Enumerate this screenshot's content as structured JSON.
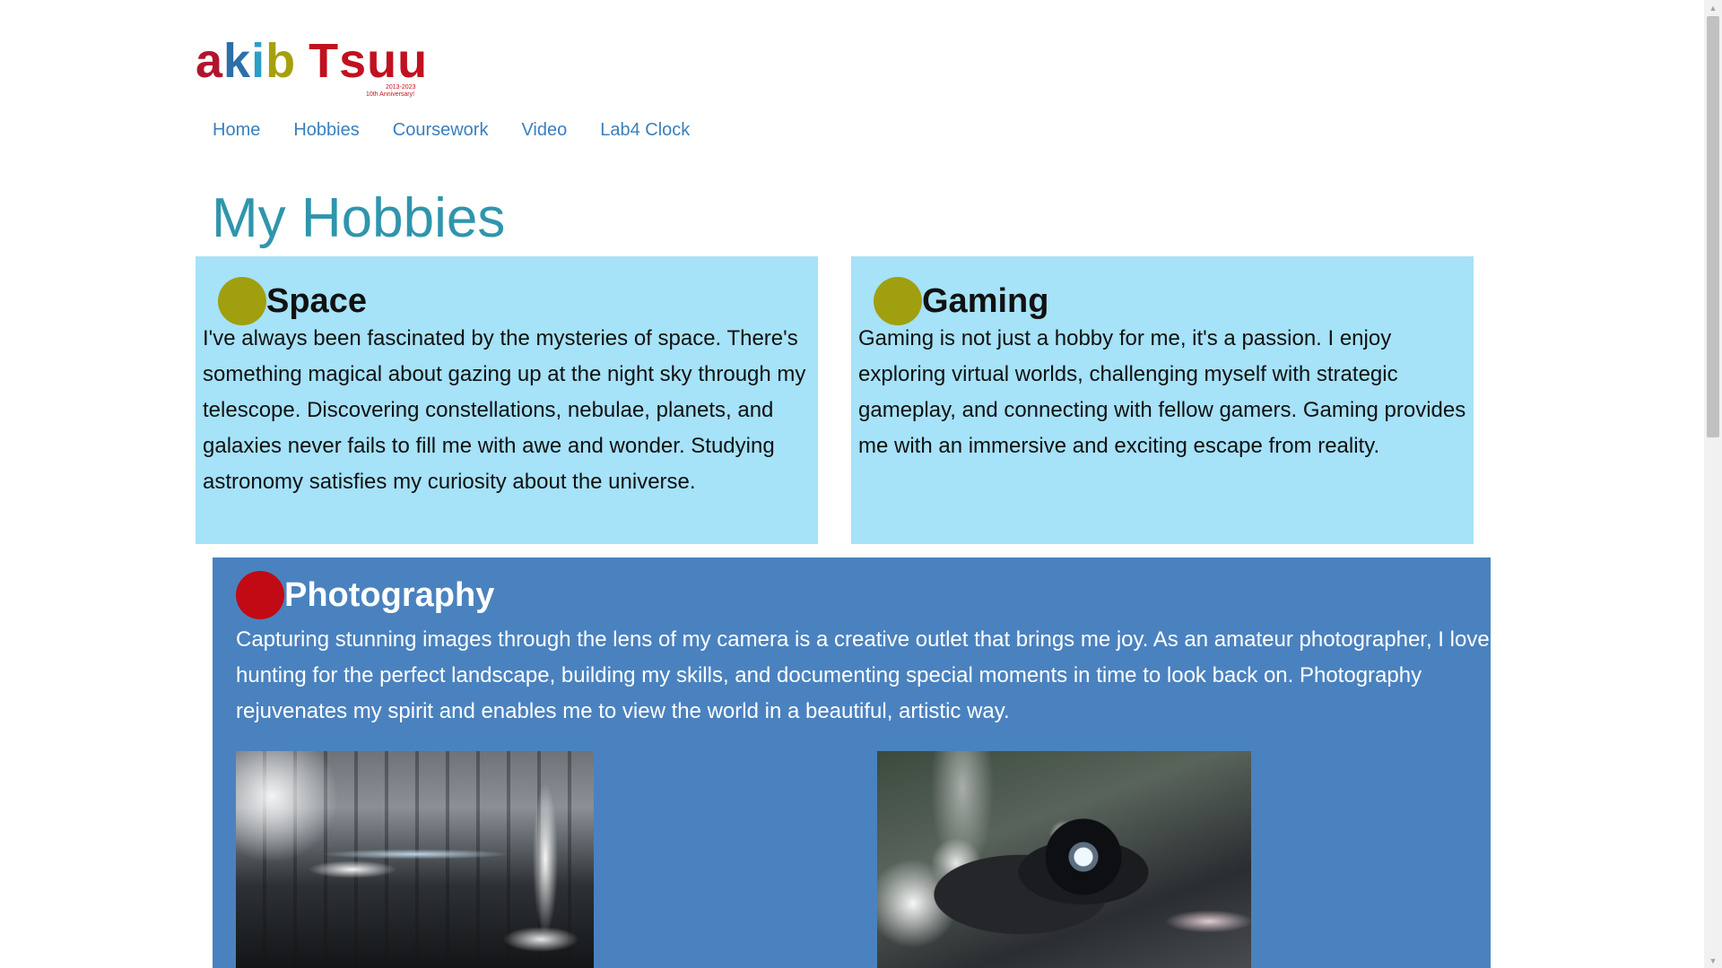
{
  "logo": {
    "letters": [
      {
        "char": "a",
        "color": "#b2142f"
      },
      {
        "char": "k",
        "color": "#2d6fa8"
      },
      {
        "char": "i",
        "color": "#2a9fc8"
      },
      {
        "char": "b",
        "color": "#a6a00f"
      },
      {
        "char": " ",
        "color": "#ffffff"
      },
      {
        "char": "T",
        "color": "#c0111f"
      },
      {
        "char": "s",
        "color": "#c0111f"
      },
      {
        "char": "u",
        "color": "#c0111f"
      },
      {
        "char": "u",
        "color": "#c0111f"
      }
    ],
    "years": "2013-2023",
    "anniversary": "10th Anniversary!"
  },
  "nav": {
    "items": [
      {
        "label": "Home"
      },
      {
        "label": "Hobbies"
      },
      {
        "label": "Coursework"
      },
      {
        "label": "Video"
      },
      {
        "label": "Lab4 Clock"
      }
    ]
  },
  "page_title": "My Hobbies",
  "hobbies": {
    "space": {
      "title": "Space",
      "text": "I've always been fascinated by the mysteries of space. There's something magical about gazing up at the night sky through my telescope. Discovering constellations, nebulae, planets, and galaxies never fails to fill me with awe and wonder. Studying astronomy satisfies my curiosity about the universe.",
      "dot_color": "#a09f0f"
    },
    "gaming": {
      "title": "Gaming",
      "text": "Gaming is not just a hobby for me, it's a passion. I enjoy exploring virtual worlds, challenging myself with strategic gameplay, and connecting with fellow gamers. Gaming provides me with an immersive and exciting escape from reality.",
      "dot_color": "#a09f0f"
    },
    "photography": {
      "title": "Photography",
      "text": "Capturing stunning images through the lens of my camera is a creative outlet that brings me joy. As an amateur photographer, I love hunting for the perfect landscape, building my skills, and documenting special moments in time to look back on. Photography rejuvenates my spirit and enables me to view the world in a beautiful, artistic way.",
      "dot_color": "#c10a14"
    }
  },
  "colors": {
    "light_card": "#a6e2f8",
    "dark_card": "#4a82bf",
    "title": "#2f95ad",
    "nav_link": "#3a7fbd"
  },
  "icons": {
    "scroll_up": "▲",
    "scroll_down": "▼"
  }
}
